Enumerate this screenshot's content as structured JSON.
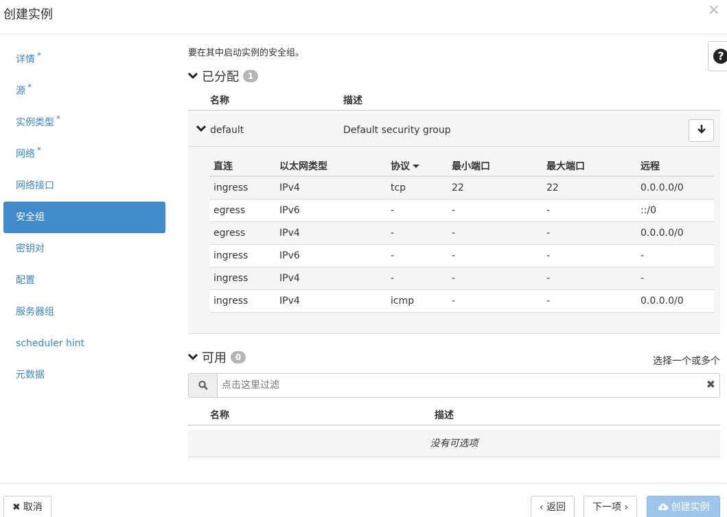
{
  "header": {
    "title": "创建实例",
    "close_icon": "×"
  },
  "sidebar": {
    "items": [
      {
        "label": "详情",
        "required": "*"
      },
      {
        "label": "源",
        "required": "*"
      },
      {
        "label": "实例类型",
        "required": "*"
      },
      {
        "label": "网络",
        "required": "*"
      },
      {
        "label": "网络接口",
        "required": ""
      },
      {
        "label": "安全组",
        "required": ""
      },
      {
        "label": "密钥对",
        "required": ""
      },
      {
        "label": "配置",
        "required": ""
      },
      {
        "label": "服务器组",
        "required": ""
      },
      {
        "label": "scheduler hint",
        "required": ""
      },
      {
        "label": "元数据",
        "required": ""
      }
    ],
    "active_index": 5
  },
  "main": {
    "help_text": "要在其中启动实例的安全组。",
    "help_icon": "?",
    "allocated": {
      "title": "已分配",
      "count": "1",
      "columns": {
        "name": "名称",
        "description": "描述"
      },
      "group": {
        "name": "default",
        "description": "Default security group",
        "rule_columns": [
          "直连",
          "以太网类型",
          "协议",
          "最小端口",
          "最大端口",
          "远程"
        ],
        "rules": [
          [
            "ingress",
            "IPv4",
            "tcp",
            "22",
            "22",
            "0.0.0.0/0"
          ],
          [
            "egress",
            "IPv6",
            "-",
            "-",
            "-",
            "::/0"
          ],
          [
            "egress",
            "IPv4",
            "-",
            "-",
            "-",
            "0.0.0.0/0"
          ],
          [
            "ingress",
            "IPv6",
            "-",
            "-",
            "-",
            "-"
          ],
          [
            "ingress",
            "IPv4",
            "-",
            "-",
            "-",
            "-"
          ],
          [
            "ingress",
            "IPv4",
            "icmp",
            "-",
            "-",
            "0.0.0.0/0"
          ]
        ]
      }
    },
    "available": {
      "title": "可用",
      "count": "0",
      "select_hint": "选择一个或多个",
      "filter_placeholder": "点击这里过滤",
      "columns": {
        "name": "名称",
        "description": "描述"
      },
      "empty_text": "没有可选项"
    }
  },
  "footer": {
    "cancel_label": "取消",
    "back_label": "‹ 返回",
    "next_label": "下一项 ›",
    "create_label": "创建实例"
  }
}
